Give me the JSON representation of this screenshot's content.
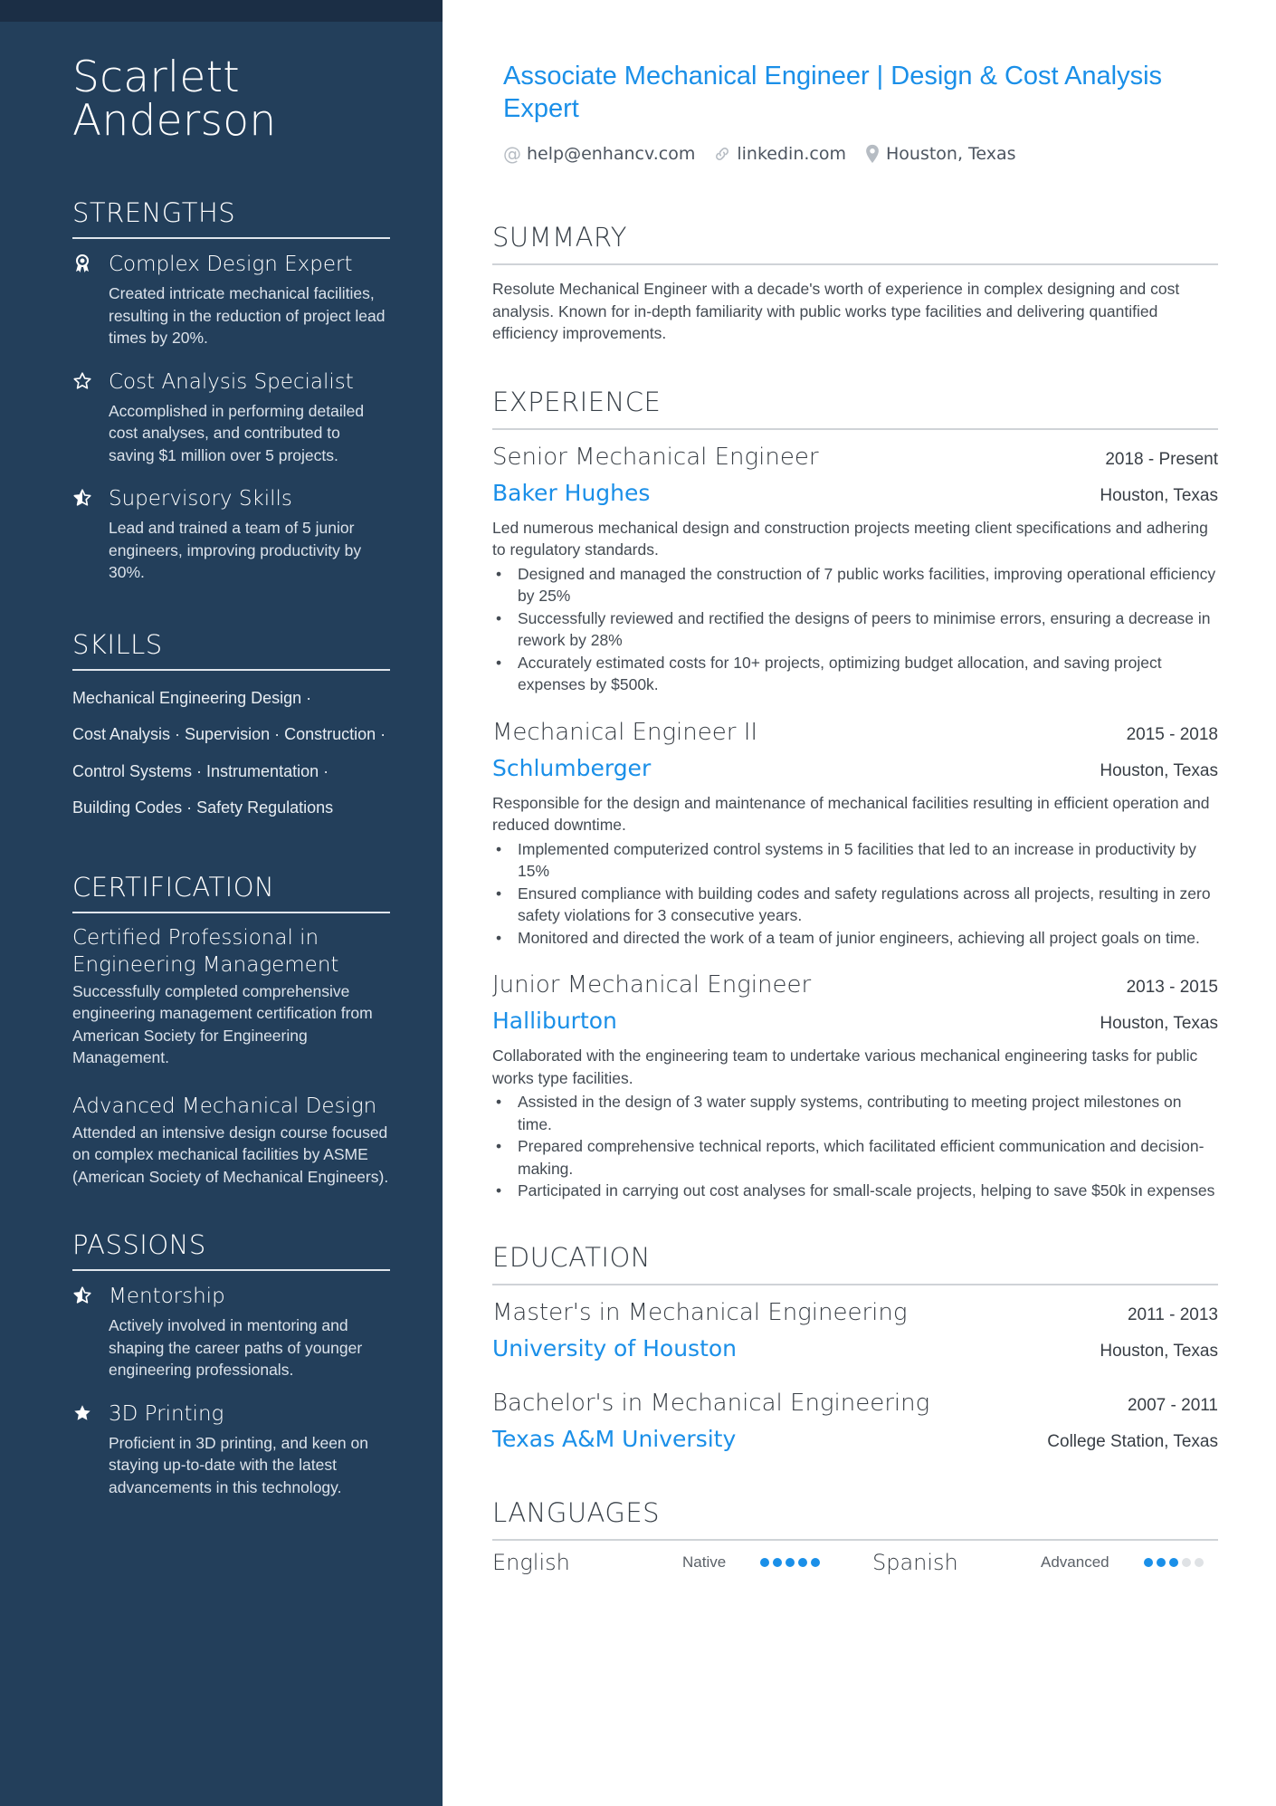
{
  "profile": {
    "name_first": "Scarlett",
    "name_last": "Anderson",
    "headline": "Associate Mechanical Engineer | Design & Cost Analysis Expert",
    "contacts": [
      {
        "icon": "at-icon",
        "text": "help@enhancv.com"
      },
      {
        "icon": "link-icon",
        "text": "linkedin.com"
      },
      {
        "icon": "location-pin-icon",
        "text": "Houston, Texas"
      }
    ]
  },
  "colors": {
    "sidebar": "#233f5b",
    "sidebar_top": "#1b2e45",
    "accent": "#1a8fe8",
    "dot_off": "#dfe2e5"
  },
  "sidebar": {
    "strengths": {
      "title": "STRENGTHS",
      "items": [
        {
          "icon": "award-ribbon-icon",
          "title": "Complex Design Expert",
          "desc": "Created intricate mechanical facilities, resulting in the reduction of project lead times by 20%."
        },
        {
          "icon": "star-outline-icon",
          "title": "Cost Analysis Specialist",
          "desc": "Accomplished in performing detailed cost analyses, and contributed to saving $1 million over 5 projects."
        },
        {
          "icon": "star-half-icon",
          "title": "Supervisory Skills",
          "desc": "Lead and trained a team of 5 junior engineers, improving productivity by 30%."
        }
      ]
    },
    "skills": {
      "title": "SKILLS",
      "lines": [
        "Mechanical Engineering Design ·",
        "Cost Analysis · Supervision · Construction ·",
        "Control Systems · Instrumentation ·",
        "Building Codes · Safety Regulations"
      ]
    },
    "certification": {
      "title": "CERTIFICATION",
      "items": [
        {
          "title": "Certified Professional in Engineering Management",
          "desc": "Successfully completed comprehensive engineering management certification from American Society for Engineering Management."
        },
        {
          "title": "Advanced Mechanical Design",
          "desc": "Attended an intensive design course focused on complex mechanical facilities by ASME (American Society of Mechanical Engineers)."
        }
      ]
    },
    "passions": {
      "title": "PASSIONS",
      "items": [
        {
          "icon": "star-half-icon",
          "title": "Mentorship",
          "desc": "Actively involved in mentoring and shaping the career paths of younger engineering professionals."
        },
        {
          "icon": "star-filled-icon",
          "title": "3D Printing",
          "desc": "Proficient in 3D printing, and keen on staying up-to-date with the latest advancements in this technology."
        }
      ]
    }
  },
  "summary": {
    "title": "SUMMARY",
    "text": "Resolute Mechanical Engineer with a decade's worth of experience in complex designing and cost analysis. Known for in-depth familiarity with public works type facilities and delivering quantified efficiency improvements."
  },
  "experience": {
    "title": "EXPERIENCE",
    "jobs": [
      {
        "title": "Senior Mechanical Engineer",
        "dates": "2018 - Present",
        "company": "Baker Hughes",
        "location": "Houston, Texas",
        "desc": "Led numerous mechanical design and construction projects meeting client specifications and adhering to regulatory standards.",
        "bullets": [
          "Designed and managed the construction of 7 public works facilities, improving operational efficiency by 25%",
          "Successfully reviewed and rectified the designs of peers to minimise errors, ensuring a decrease in rework by 28%",
          "Accurately estimated costs for 10+ projects, optimizing budget allocation, and saving project expenses by $500k."
        ]
      },
      {
        "title": "Mechanical Engineer II",
        "dates": "2015 - 2018",
        "company": "Schlumberger",
        "location": "Houston, Texas",
        "desc": "Responsible for the design and maintenance of mechanical facilities resulting in efficient operation and reduced downtime.",
        "bullets": [
          "Implemented computerized control systems in 5 facilities that led to an increase in productivity by 15%",
          "Ensured compliance with building codes and safety regulations across all projects, resulting in zero safety violations for 3 consecutive years.",
          "Monitored and directed the work of a team of junior engineers, achieving all project goals on time."
        ]
      },
      {
        "title": "Junior Mechanical Engineer",
        "dates": "2013 - 2015",
        "company": "Halliburton",
        "location": "Houston, Texas",
        "desc": "Collaborated with the engineering team to undertake various mechanical engineering tasks for public works type facilities.",
        "bullets": [
          "Assisted in the design of 3 water supply systems, contributing to meeting project milestones on time.",
          "Prepared comprehensive technical reports, which facilitated efficient communication and decision-making.",
          "Participated in carrying out cost analyses for small-scale projects, helping to save $50k in expenses"
        ]
      }
    ]
  },
  "education": {
    "title": "EDUCATION",
    "items": [
      {
        "degree": "Master's in Mechanical Engineering",
        "dates": "2011 - 2013",
        "school": "University of Houston",
        "location": "Houston, Texas"
      },
      {
        "degree": "Bachelor's in Mechanical Engineering",
        "dates": "2007 - 2011",
        "school": "Texas A&M University",
        "location": "College Station, Texas"
      }
    ]
  },
  "languages": {
    "title": "LANGUAGES",
    "items": [
      {
        "name": "English",
        "level": "Native",
        "rating": 5,
        "max": 5
      },
      {
        "name": "Spanish",
        "level": "Advanced",
        "rating": 3,
        "max": 5
      }
    ]
  }
}
